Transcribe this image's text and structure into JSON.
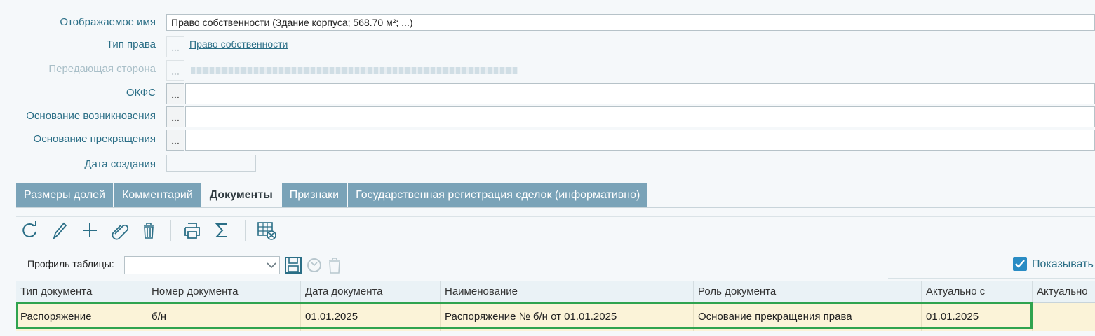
{
  "form": {
    "display_name_label": "Отображаемое имя",
    "display_name_value": "Право собственности (Здание корпуса; 568.70 м²; ...)",
    "right_type_label": "Тип права",
    "right_type_value": "Право собственности",
    "transferring_party_label": "Передающая сторона",
    "okfs_label": "ОКФС",
    "basis_origin_label": "Основание возникновения",
    "basis_termination_label": "Основание прекращения",
    "creation_date_label": "Дата создания",
    "dots": "..."
  },
  "tabs": [
    {
      "label": "Размеры долей",
      "active": false
    },
    {
      "label": "Комментарий",
      "active": false
    },
    {
      "label": "Документы",
      "active": true
    },
    {
      "label": "Признаки",
      "active": false
    },
    {
      "label": "Государственная регистрация сделок (информативно)",
      "active": false
    }
  ],
  "toolbar": {
    "icons": [
      "refresh-icon",
      "edit-icon",
      "add-icon",
      "attach-icon",
      "delete-icon",
      "print-icon",
      "sum-icon",
      "table-settings-icon"
    ]
  },
  "profile": {
    "label": "Профиль таблицы:",
    "value": "",
    "show_label": "Показывать",
    "show_checked": true
  },
  "table": {
    "columns": [
      "Тип документа",
      "Номер документа",
      "Дата документа",
      "Наименование",
      "Роль документа",
      "Актуально с",
      "Актуально"
    ],
    "rows": [
      [
        "Распоряжение",
        "б/н",
        "01.01.2025",
        "Распоряжение № б/н от 01.01.2025",
        "Основание прекращения права",
        "01.01.2025",
        ""
      ]
    ]
  },
  "colors": {
    "accent": "#2a6e86",
    "tab_bg": "#7aa3b8",
    "row_highlight": "#fbf3d8",
    "selection_border": "#2fa34f"
  }
}
